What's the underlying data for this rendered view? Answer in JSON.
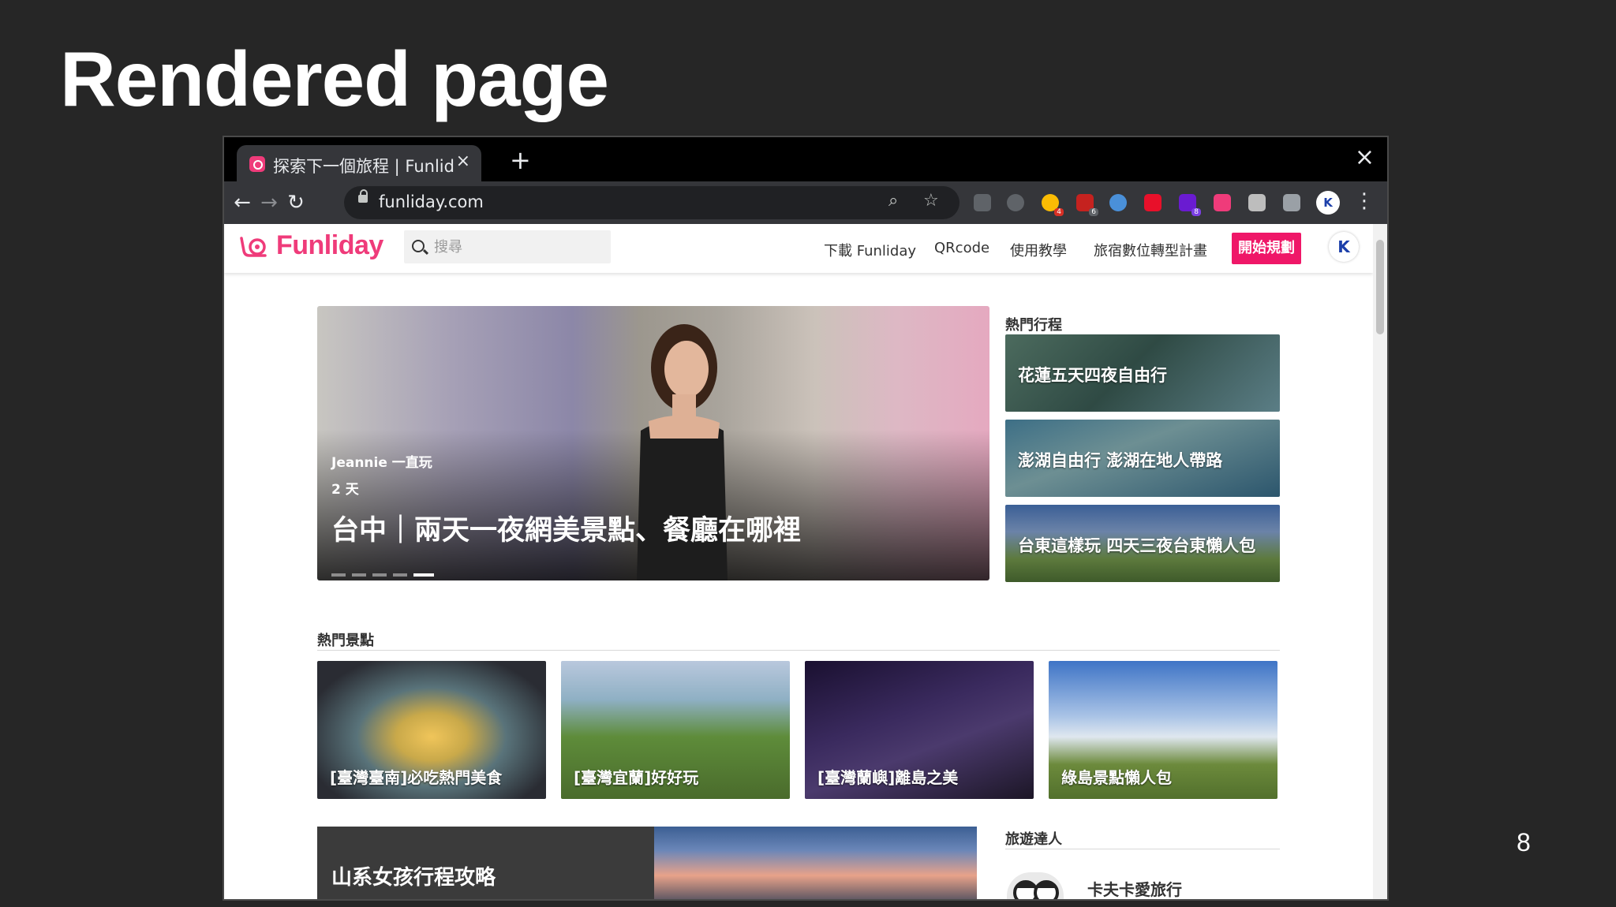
{
  "slide": {
    "title": "Rendered page",
    "page_number": "8"
  },
  "browser": {
    "tab_title": "探索下一個旅程 | Funliday",
    "tab_close": "×",
    "new_tab": "+",
    "window_close": "×",
    "url": "funliday.com",
    "back": "←",
    "forward": "→",
    "reload": "↻",
    "menu": "⋮",
    "ext_badges": [
      "4",
      "6",
      "8"
    ],
    "profile_initial": "K"
  },
  "site": {
    "logo_text": "Funliday",
    "search_placeholder": "搜尋",
    "nav": [
      "下載 Funliday",
      "QRcode",
      "使用教學",
      "旅宿數位轉型計畫"
    ],
    "cta": "開始規劃",
    "avatar_text": "K",
    "hero": {
      "author": "Jeannie 一直玩",
      "days": "2 天",
      "title": "台中｜兩天一夜網美景點、餐廳在哪裡",
      "slide_count": 5,
      "active_slide": 5
    },
    "popular_trips": {
      "heading": "熱門行程",
      "items": [
        "花蓮五天四夜自由行",
        "澎湖自由行 澎湖在地人帶路",
        "台東這樣玩 四天三夜台東懶人包"
      ]
    },
    "popular_spots": {
      "heading": "熱門景點",
      "items": [
        "[臺灣臺南]必吃熱門美食",
        "[臺灣宜蘭]好好玩",
        "[臺灣蘭嶼]離島之美",
        "綠島景點懶人包"
      ]
    },
    "guide": {
      "title": "山系女孩行程攻略"
    },
    "experts": {
      "heading": "旅遊達人",
      "first_name": "卡夫卡愛旅行"
    },
    "colors": {
      "brand": "#ef3b7a",
      "cta": "#ef1768"
    }
  }
}
